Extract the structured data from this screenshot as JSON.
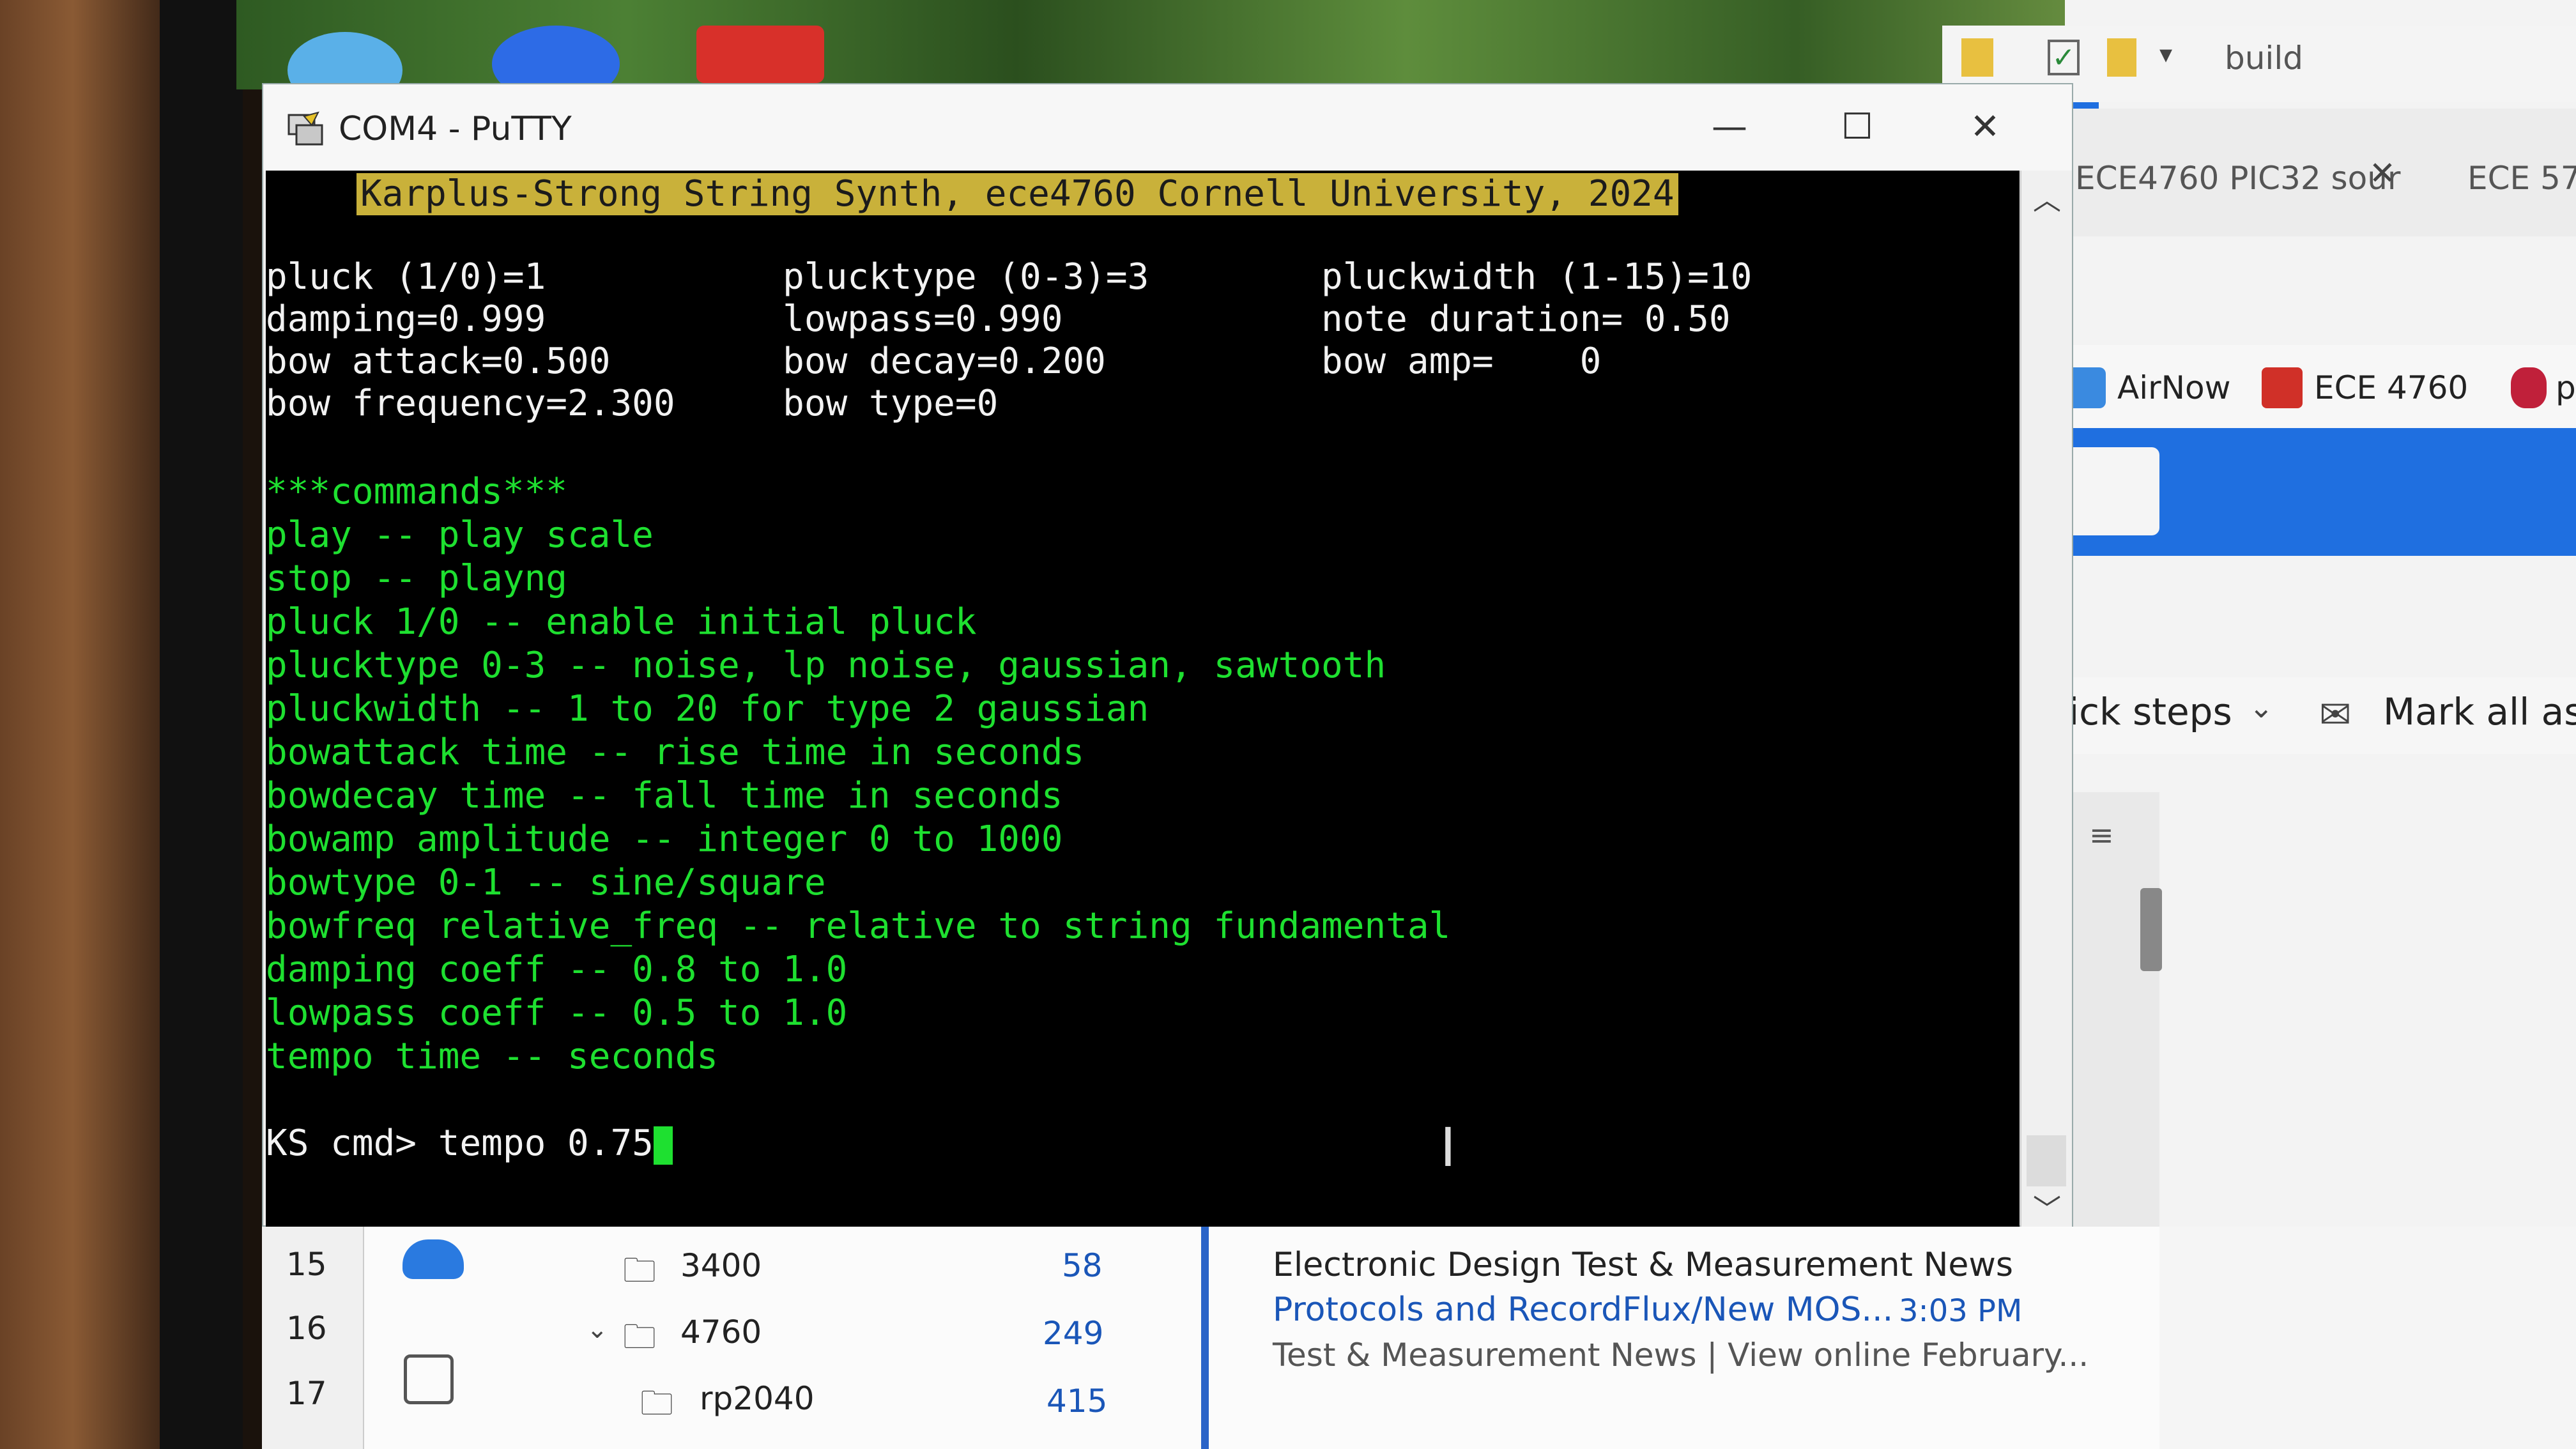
{
  "window": {
    "title": "COM4 - PuTTY",
    "controls": {
      "minimize": "—",
      "maximize": "☐",
      "close": "✕"
    }
  },
  "terminal": {
    "banner": "Karplus-Strong String Synth, ece4760 Cornell University, 2024",
    "params": [
      "pluck (1/0)=1           plucktype (0-3)=3        pluckwidth (1-15)=10",
      "damping=0.999           lowpass=0.990            note duration= 0.50",
      "bow attack=0.500        bow decay=0.200          bow amp=    0",
      "bow frequency=2.300     bow type=0"
    ],
    "commands_header": "***commands***",
    "commands": [
      "play -- play scale",
      "stop -- playng",
      "pluck 1/0 -- enable initial pluck",
      "plucktype 0-3 -- noise, lp noise, gaussian, sawtooth",
      "pluckwidth -- 1 to 20 for type 2 gaussian",
      "bowattack time -- rise time in seconds",
      "bowdecay time -- fall time in seconds",
      "bowamp amplitude -- integer 0 to 1000",
      "bowtype 0-1 -- sine/square",
      "bowfreq relative_freq -- relative to string fundamental",
      "damping coeff -- 0.8 to 1.0",
      "lowpass coeff -- 0.5 to 1.0",
      "tempo time -- seconds"
    ],
    "prompt": "KS cmd> tempo 0.75"
  },
  "browser": {
    "toolbar_label": "build",
    "tabs": [
      "ECE4760 PIC32 sour",
      "ECE 57"
    ],
    "bookmarks": [
      "AirNow",
      "ECE 4760",
      "pi"
    ],
    "ribbon": [
      "ick steps",
      "Mark all as"
    ]
  },
  "outlook": {
    "row_numbers": [
      "15",
      "16",
      "17"
    ],
    "folders": [
      {
        "name": "3400",
        "count": "58"
      },
      {
        "name": "4760",
        "count": "249"
      },
      {
        "name": "rp2040",
        "count": "415"
      }
    ],
    "email": {
      "sender": "Electronic Design Test & Measurement News",
      "subject": "Protocols and RecordFlux/New MOS...",
      "time": "3:03 PM",
      "preview": "Test & Measurement News | View online February..."
    }
  },
  "colors": {
    "terminal_bg": "#000000",
    "terminal_green": "#1ee030",
    "banner_bg": "#c9b13a",
    "accent_blue": "#1f6fe0"
  }
}
